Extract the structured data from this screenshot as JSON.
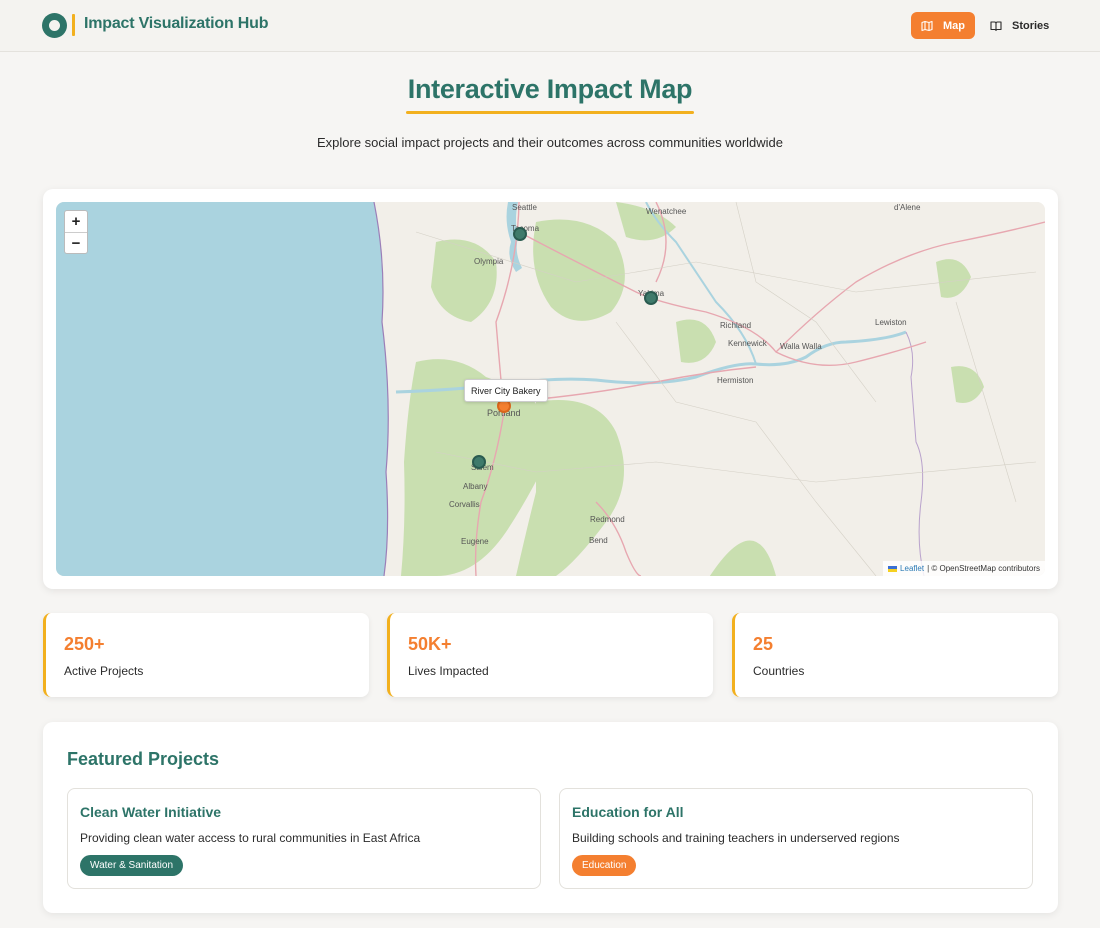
{
  "header": {
    "brand": "Impact Visualization Hub",
    "nav": [
      {
        "label": "Map",
        "icon": "map-icon",
        "active": true
      },
      {
        "label": "Stories",
        "icon": "book-icon",
        "active": false
      }
    ]
  },
  "hero": {
    "title": "Interactive Impact Map",
    "subtitle": "Explore social impact projects and their outcomes across communities worldwide"
  },
  "map": {
    "zoom_in": "+",
    "zoom_out": "−",
    "tooltip": "River City Bakery",
    "places": [
      "Seattle",
      "Wenatchee",
      "d'Alene",
      "Tacoma",
      "Olympia",
      "Yakima",
      "Richland",
      "Kennewick",
      "Walla Walla",
      "Lewiston",
      "Hermiston",
      "Portland",
      "Salem",
      "Albany",
      "Corvallis",
      "Redmond",
      "Eugene",
      "Bend"
    ],
    "attribution_leaflet": "Leaflet",
    "attribution_rest": "| © OpenStreetMap contributors",
    "marker_count": 4
  },
  "stats": [
    {
      "value": "250+",
      "label": "Active Projects"
    },
    {
      "value": "50K+",
      "label": "Lives Impacted"
    },
    {
      "value": "25",
      "label": "Countries"
    }
  ],
  "featured": {
    "title": "Featured Projects",
    "projects": [
      {
        "title": "Clean Water Initiative",
        "description": "Providing clean water access to rural communities in East Africa",
        "tag": "Water & Sanitation",
        "tag_color": "#2d7468"
      },
      {
        "title": "Education for All",
        "description": "Building schools and training teachers in underserved regions",
        "tag": "Education",
        "tag_color": "#f47f30"
      }
    ]
  },
  "colors": {
    "primary": "#2d7468",
    "accent": "#f47f30",
    "highlight": "#f2b01e"
  }
}
